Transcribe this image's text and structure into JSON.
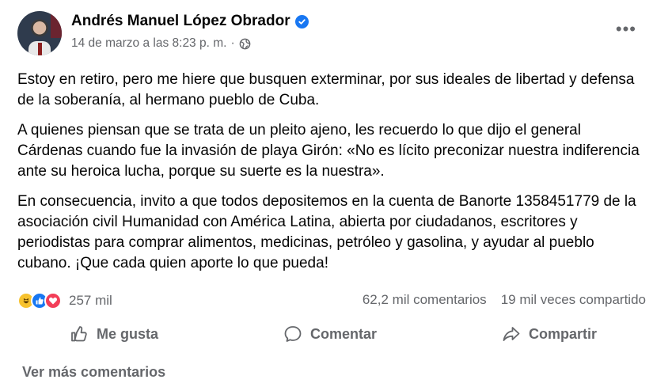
{
  "post": {
    "author": "Andrés Manuel López Obrador",
    "timestamp": "14 de marzo a las 8:23 p. m.",
    "separator": "·",
    "privacy_icon": "globe-icon",
    "verified_icon": "verified-badge-icon",
    "more_icon": "more-options-icon",
    "more_glyph": "•••",
    "paragraphs": [
      "Estoy en retiro, pero me hiere que busquen exterminar, por sus ideales de libertad y defensa de la soberanía, al hermano pueblo de Cuba.",
      "A quienes piensan que se trata de un pleito ajeno, les recuerdo lo que dijo el general Cárdenas cuando fue la invasión de playa Girón: «No es lícito preconizar nuestra indiferencia ante su heroica lucha, porque su suerte es la nuestra».",
      "En consecuencia, invito a que todos depositemos en la cuenta de Banorte 1358451779 de la asociación civil Humanidad con América Latina, abierta por ciudadanos, escritores y periodistas para comprar alimentos, medicinas, petróleo y gasolina, y ayudar al pueblo cubano. ¡Que cada quien aporte lo que pueda!"
    ]
  },
  "stats": {
    "reaction_icons": [
      "haha-reaction-icon",
      "like-reaction-icon",
      "love-reaction-icon"
    ],
    "reactions": "257 mil",
    "comments": "62,2 mil comentarios",
    "shares": "19 mil veces compartido"
  },
  "actions": {
    "like": "Me gusta",
    "comment": "Comentar",
    "share": "Compartir"
  },
  "footer": {
    "more_comments": "Ver más comentarios"
  },
  "colors": {
    "brand_blue": "#1877f2",
    "secondary_text": "#65676b",
    "primary_text": "#050505"
  }
}
